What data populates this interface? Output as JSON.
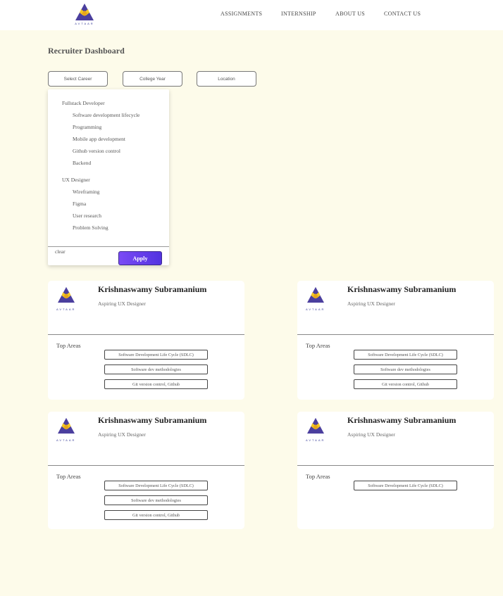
{
  "brand": {
    "name": "AVTAAR"
  },
  "nav": {
    "assignments": "ASSIGNMENTS",
    "internship": "INTERNSHIP",
    "about": "ABOUT US",
    "contact": "CONTACT US"
  },
  "page": {
    "title": "Recruiter Dashboard"
  },
  "filters": {
    "career": "Select Career",
    "year": "College Year",
    "location": "Location"
  },
  "dropdown": {
    "groups": [
      {
        "label": "Fullstack Developer",
        "items": [
          "Software development lifecycle",
          "Programming",
          "Mobile app development",
          "Github version control",
          "Backend"
        ]
      },
      {
        "label": "UX Designer",
        "items": [
          "Wireframing",
          "Figma",
          "User research",
          "Problem Solving"
        ]
      }
    ],
    "clear": "clear",
    "apply": "Apply"
  },
  "cards": [
    {
      "name": "Krishnaswamy Subramanium",
      "role": "Aspiring UX Designer",
      "top_areas_label": "Top Areas",
      "tags": [
        "Software Development Life Cycle (SDLC)",
        "Software dev methodologies",
        "Git version control, Github"
      ]
    },
    {
      "name": "Krishnaswamy Subramanium",
      "role": "Aspiring UX Designer",
      "top_areas_label": "Top Areas",
      "tags": [
        "Software Development Life Cycle (SDLC)",
        "Software dev methodologies",
        "Git version control, Github"
      ]
    },
    {
      "name": "Krishnaswamy Subramanium",
      "role": "Aspiring UX Designer",
      "top_areas_label": "Top Areas",
      "tags": [
        "Software Development Life Cycle (SDLC)",
        "Software dev methodologies",
        "Git version control, Github"
      ]
    },
    {
      "name": "Krishnaswamy Subramanium",
      "role": "Aspiring UX Designer",
      "top_areas_label": "Top Areas",
      "tags": [
        "Software Development Life Cycle (SDLC)"
      ]
    }
  ],
  "colors": {
    "background": "#fdfbea",
    "logo_purple": "#4b3f9e",
    "logo_yellow": "#f3c623",
    "apply_gradient_start": "#7a4bf5",
    "apply_gradient_end": "#5233e0"
  }
}
